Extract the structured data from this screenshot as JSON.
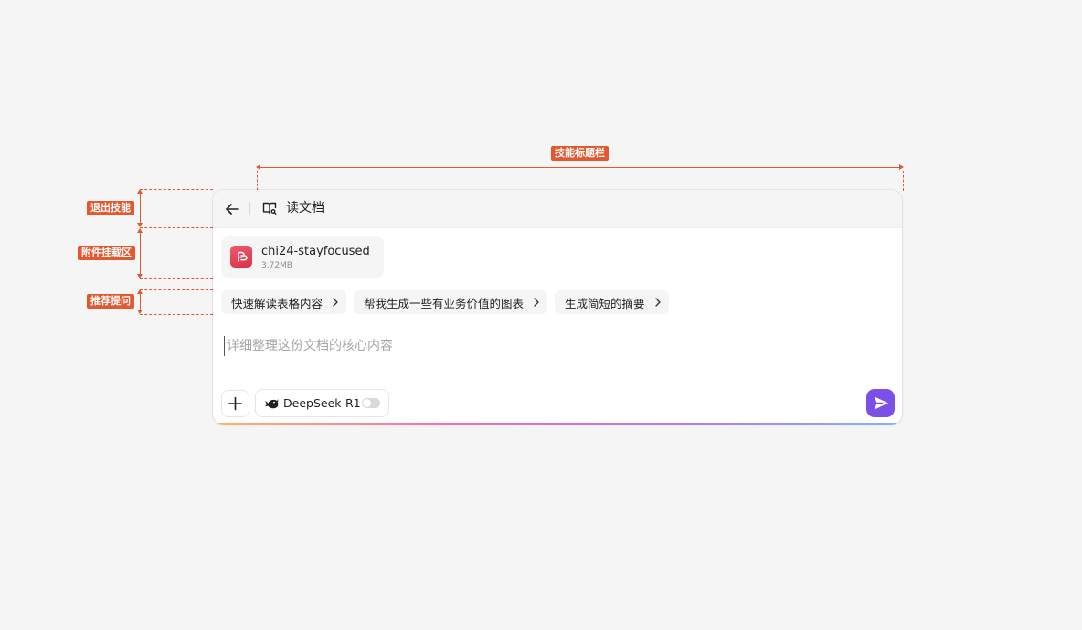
{
  "annotations": {
    "title_bar": "技能标题栏",
    "exit_skill": "退出技能",
    "attachment_area": "附件挂载区",
    "suggested_questions": "推荐提问"
  },
  "skill": {
    "title": "读文档"
  },
  "attachment": {
    "file_name": "chi24-stayfocused",
    "file_size": "3.72MB"
  },
  "suggestions": [
    {
      "label": "快速解读表格内容"
    },
    {
      "label": "帮我生成一些有业务价值的图表"
    },
    {
      "label": "生成简短的摘要"
    }
  ],
  "input": {
    "placeholder": "详细整理这份文档的核心内容",
    "value": ""
  },
  "toolbar": {
    "model_label": "DeepSeek-R1",
    "model_toggle_on": false
  },
  "colors": {
    "annotation": "#e2582f",
    "send_button": "#7b4fe8",
    "pdf_icon": "#e0475c"
  }
}
